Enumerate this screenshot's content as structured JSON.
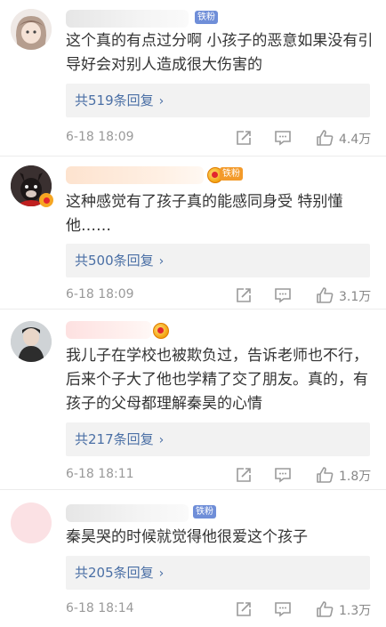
{
  "comments": [
    {
      "badge": "铁粉",
      "text": "这个真的有点过分啊 小孩子的恶意如果没有引导好会对别人造成很大伤害的",
      "replies": "共519条回复",
      "time": "6-18 18:09",
      "likes": "4.4万"
    },
    {
      "badge": "铁粉",
      "text": "这种感觉有了孩子真的能感同身受 特别懂他……",
      "replies": "共500条回复",
      "time": "6-18 18:09",
      "likes": "3.1万"
    },
    {
      "text": "我儿子在学校也被欺负过，告诉老师也不行，后来个子大了他也学精了交了朋友。真的，有孩子的父母都理解秦昊的心情",
      "replies": "共217条回复",
      "time": "6-18 18:11",
      "likes": "1.8万"
    },
    {
      "badge": "铁粉",
      "text": "秦昊哭的时候就觉得他很爱这个孩子",
      "replies": "共205条回复",
      "time": "6-18 18:14",
      "likes": "1.3万"
    }
  ],
  "icons": {
    "reply_chevron": "chevron-right-icon",
    "share": "share-icon",
    "comment": "comment-icon",
    "like": "thumbs-up-icon"
  },
  "colors": {
    "link": "#4a6fa5",
    "badge": "#6f8ed8",
    "badge_gold": "#f39a2a",
    "muted": "#999999"
  }
}
